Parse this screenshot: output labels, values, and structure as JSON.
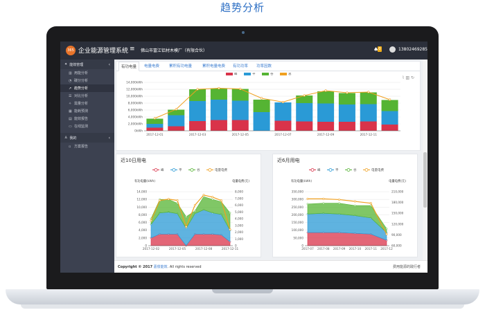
{
  "page_heading": "趋势分析",
  "topbar": {
    "logo_text": "365",
    "app_title": "企业能源管理系统",
    "menu_icon": "menu-icon",
    "company": "佛山市富江铝材木模厂（有限合伙）",
    "bell_badge": "0",
    "phone": "13802469285"
  },
  "sidebar": {
    "section_energy": "能效管理",
    "items": [
      {
        "label": "用能分析",
        "icon": "bar-chart-icon"
      },
      {
        "label": "碳分分析",
        "icon": "pie-icon"
      },
      {
        "label": "趋势分析",
        "icon": "trend-icon",
        "active": true
      },
      {
        "label": "对比分析",
        "icon": "compare-icon"
      },
      {
        "label": "需量分析",
        "icon": "gauge-icon"
      },
      {
        "label": "能耗预测",
        "icon": "calendar-icon"
      },
      {
        "label": "能效报告",
        "icon": "report-icon"
      },
      {
        "label": "在线监测",
        "icon": "monitor-icon"
      }
    ],
    "section_mine": "我的",
    "mine_items": [
      {
        "label": "方案报告",
        "icon": "doc-icon"
      }
    ]
  },
  "tabs": [
    "有功电量",
    "电量电费",
    "累积有功电量",
    "累积电量电费",
    "有功功率",
    "功率因数"
  ],
  "colors": {
    "peak": "#d9334a",
    "flat": "#2a9ad6",
    "valley": "#55b433",
    "total": "#f0a020"
  },
  "chart_data": [
    {
      "type": "bar",
      "legend": [
        "峰",
        "平",
        "谷",
        "总"
      ],
      "ylabels": [
        "0kWh",
        "2,000kWh",
        "4,000kWh",
        "6,000kWh",
        "8,000kWh",
        "10,000kWh",
        "12,000kWh",
        "14,000kWh"
      ],
      "ylim": [
        0,
        14000
      ],
      "categories": [
        "2017-12-01",
        "2017-12-02",
        "2017-12-03",
        "2017-12-04",
        "2017-12-05",
        "2017-12-06",
        "2017-12-07",
        "2017-12-08",
        "2017-12-09",
        "2017-12-10",
        "2017-12-11",
        "2017-12-12"
      ],
      "xlabels": [
        "2017-12-01",
        "2017-12-03",
        "2017-12-05",
        "2017-12-07",
        "2017-12-09",
        "2017-12-11"
      ],
      "series": [
        {
          "name": "峰",
          "values": [
            900,
            1300,
            2800,
            3100,
            3100,
            0,
            2900,
            2700,
            2600,
            2600,
            2700,
            1800
          ]
        },
        {
          "name": "平",
          "values": [
            1100,
            3200,
            5800,
            5900,
            5600,
            5400,
            5300,
            5300,
            5300,
            5000,
            5000,
            3900
          ]
        },
        {
          "name": "谷",
          "values": [
            1500,
            1600,
            3400,
            3300,
            3400,
            3600,
            0,
            2200,
            3500,
            3300,
            3400,
            3200
          ]
        }
      ],
      "total_line": [
        3600,
        6200,
        12000,
        12300,
        12100,
        9400,
        8300,
        10200,
        11600,
        11000,
        11200,
        9000
      ]
    },
    {
      "type": "area",
      "title": "近10日用电",
      "legend": [
        "峰",
        "平",
        "谷",
        "电量电费"
      ],
      "ylabel_left": "有功电量(kWh)",
      "ylabel_right": "电量电费(元)",
      "ylabels_left": [
        "0",
        "2,000",
        "4,000",
        "6,000",
        "8,000",
        "10,000",
        "12,000",
        "14,000"
      ],
      "ylabels_right": [
        "0",
        "1,000",
        "2,000",
        "3,000",
        "4,000",
        "5,000",
        "6,000",
        "7,000",
        "8,000"
      ],
      "ylim": [
        0,
        14000
      ],
      "ylim_right": [
        0,
        8000
      ],
      "xlabels": [
        "2017-12-02",
        "2017-12-05",
        "2017-12-08",
        "2017-12-11"
      ],
      "series": [
        {
          "name": "峰",
          "values": [
            2000,
            3000,
            3000,
            3000,
            0,
            3000,
            3000,
            3000,
            2800,
            1000
          ]
        },
        {
          "name": "平",
          "values": [
            3500,
            5500,
            5700,
            5300,
            4500,
            5300,
            6300,
            5500,
            5300,
            3000
          ]
        },
        {
          "name": "谷",
          "values": [
            1500,
            3500,
            3300,
            2700,
            3000,
            700,
            3400,
            3500,
            3300,
            4500
          ]
        }
      ],
      "cost_line": [
        3700,
        6700,
        6900,
        6700,
        2800,
        6000,
        7500,
        7200,
        6700,
        2400
      ]
    },
    {
      "type": "area",
      "title": "近6月用电",
      "legend": [
        "峰",
        "平",
        "谷",
        "电量电费"
      ],
      "ylabel_left": "有功电量(kWh)",
      "ylabel_right": "电量电费(元)",
      "ylabels_left": [
        "0",
        "50,000",
        "100,000",
        "150,000",
        "200,000",
        "250,000",
        "300,000",
        "350,000"
      ],
      "ylabels_right": [
        "60,000",
        "90,000",
        "120,000",
        "150,000",
        "180,000",
        "210,000"
      ],
      "ylim": [
        0,
        350000
      ],
      "ylim_right": [
        60000,
        210000
      ],
      "xlabels": [
        "2017-07",
        "2017-08",
        "2017-09",
        "2017-10",
        "2017-11",
        "2017-12"
      ],
      "series": [
        {
          "name": "峰",
          "values": [
            85000,
            85000,
            85000,
            80000,
            75000,
            35000
          ]
        },
        {
          "name": "平",
          "values": [
            120000,
            125000,
            120000,
            115000,
            105000,
            50000
          ]
        },
        {
          "name": "谷",
          "values": [
            65000,
            65000,
            70000,
            65000,
            80000,
            25000
          ]
        }
      ],
      "cost_line": [
        190000,
        190000,
        188000,
        183000,
        178000,
        92000
      ]
    }
  ],
  "footer": {
    "prefix": "Copyright © 2017",
    "link": "嘉俊能效",
    "suffix": ". All rights reserved",
    "right": "费用能源的践行者"
  }
}
